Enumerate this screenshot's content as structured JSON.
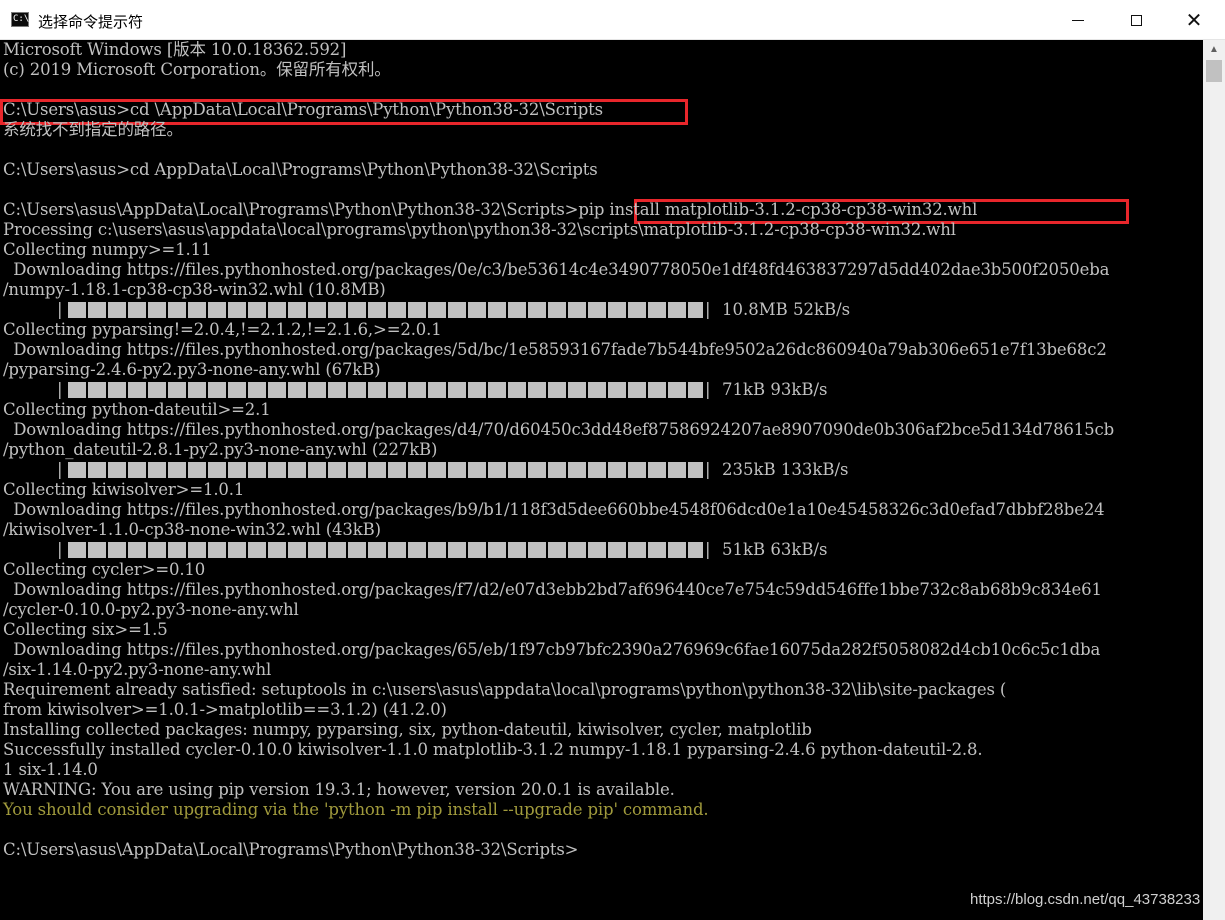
{
  "window": {
    "title": "选择命令提示符",
    "icon": "cmd-icon",
    "icon_text": "C:\\",
    "controls": {
      "minimize": "minimize-icon",
      "maximize": "maximize-icon",
      "close": "close-icon",
      "close_glyph": "✕"
    }
  },
  "console": {
    "lines": [
      "Microsoft Windows [版本 10.0.18362.592]",
      "(c) 2019 Microsoft Corporation。保留所有权利。",
      "",
      "C:\\Users\\asus>cd \\AppData\\Local\\Programs\\Python\\Python38-32\\Scripts",
      "系统找不到指定的路径。",
      "",
      "C:\\Users\\asus>cd AppData\\Local\\Programs\\Python\\Python38-32\\Scripts",
      "",
      "C:\\Users\\asus\\AppData\\Local\\Programs\\Python\\Python38-32\\Scripts>pip install matplotlib-3.1.2-cp38-cp38-win32.whl",
      "Processing c:\\users\\asus\\appdata\\local\\programs\\python\\python38-32\\scripts\\matplotlib-3.1.2-cp38-cp38-win32.whl",
      "Collecting numpy>=1.11",
      "  Downloading https://files.pythonhosted.org/packages/0e/c3/be53614c4e3490778050e1df48fd463837297d5dd402dae3b500f2050eba",
      "/numpy-1.18.1-cp38-cp38-win32.whl (10.8MB)",
      "",
      "Collecting pyparsing!=2.0.4,!=2.1.2,!=2.1.6,>=2.0.1",
      "  Downloading https://files.pythonhosted.org/packages/5d/bc/1e58593167fade7b544bfe9502a26dc860940a79ab306e651e7f13be68c2",
      "/pyparsing-2.4.6-py2.py3-none-any.whl (67kB)",
      "",
      "Collecting python-dateutil>=2.1",
      "  Downloading https://files.pythonhosted.org/packages/d4/70/d60450c3dd48ef87586924207ae8907090de0b306af2bce5d134d78615cb",
      "/python_dateutil-2.8.1-py2.py3-none-any.whl (227kB)",
      "",
      "Collecting kiwisolver>=1.0.1",
      "  Downloading https://files.pythonhosted.org/packages/b9/b1/118f3d5dee660bbe4548f06dcd0e1a10e45458326c3d0efad7dbbf28be24",
      "/kiwisolver-1.1.0-cp38-none-win32.whl (43kB)",
      "",
      "Collecting cycler>=0.10",
      "  Downloading https://files.pythonhosted.org/packages/f7/d2/e07d3ebb2bd7af696440ce7e754c59dd546ffe1bbe732c8ab68b9c834e61",
      "/cycler-0.10.0-py2.py3-none-any.whl",
      "Collecting six>=1.5",
      "  Downloading https://files.pythonhosted.org/packages/65/eb/1f97cb97bfc2390a276969c6fae16075da282f5058082d4cb10c6c5c1dba",
      "/six-1.14.0-py2.py3-none-any.whl",
      "Requirement already satisfied: setuptools in c:\\users\\asus\\appdata\\local\\programs\\python\\python38-32\\lib\\site-packages (",
      "from kiwisolver>=1.0.1->matplotlib==3.1.2) (41.2.0)",
      "Installing collected packages: numpy, pyparsing, six, python-dateutil, kiwisolver, cycler, matplotlib",
      "Successfully installed cycler-0.10.0 kiwisolver-1.1.0 matplotlib-3.1.2 numpy-1.18.1 pyparsing-2.4.6 python-dateutil-2.8.",
      "1 six-1.14.0",
      "WARNING: You are using pip version 19.3.1; however, version 20.0.1 is available.",
      "You should consider upgrading via the 'python -m pip install --upgrade pip' command.",
      "",
      "C:\\Users\\asus\\AppData\\Local\\Programs\\Python\\Python38-32\\Scripts>"
    ],
    "warning_line_indices": [
      38,
      39
    ],
    "progress_bars": [
      {
        "line_index": 13,
        "stats": "10.8MB 52kB/s",
        "progress": 1.0
      },
      {
        "line_index": 17,
        "stats": "71kB 93kB/s",
        "progress": 1.0
      },
      {
        "line_index": 21,
        "stats": "235kB 133kB/s",
        "progress": 1.0
      },
      {
        "line_index": 25,
        "stats": "51kB 63kB/s",
        "progress": 1.0
      }
    ],
    "text_color": "#c0c0c0",
    "warning_color": "#a09a3c",
    "background": "#000000",
    "highlight_color": "#e8262b"
  },
  "watermark": "https://blog.csdn.net/qq_43738233"
}
